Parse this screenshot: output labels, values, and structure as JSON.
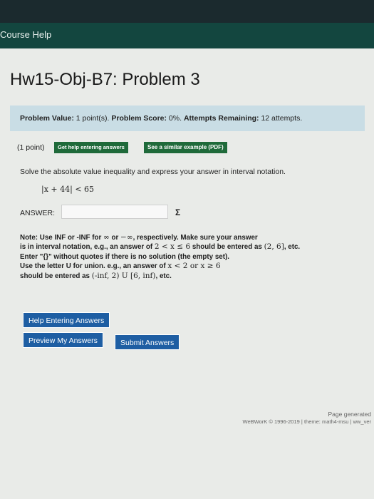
{
  "header": {
    "course_help": "Course Help"
  },
  "page": {
    "title": "Hw15-Obj-B7: Problem 3"
  },
  "info": {
    "value_label": "Problem Value:",
    "value": "1 point(s).",
    "score_label": "Problem Score:",
    "score": "0%.",
    "attempts_label": "Attempts Remaining:",
    "attempts": "12 attempts."
  },
  "problem": {
    "points": "(1 point)",
    "help_button": "Get help entering answers",
    "similar_button": "See a similar example (PDF)",
    "prompt": "Solve the absolute value inequality and express your answer in interval notation.",
    "inequality": "|x + 44| < 65",
    "answer_label": "ANSWER:",
    "answer_value": "",
    "sigma": "Σ",
    "note_line1a": "Note: Use INF or -INF for ",
    "note_line1_inf": "∞",
    "note_line1b": " or ",
    "note_line1_neginf": "−∞",
    "note_line1c": ", respectively. Make sure your answer",
    "note_line2a": "is in interval notation, e.g., an answer of ",
    "note_line2_math": "2 < x ≤ 6",
    "note_line2b": " should be entered as ",
    "note_line2_int": "(2, 6]",
    "note_line2c": ", etc.",
    "note_line3": "Enter \"{}\" without quotes if there is no solution (the empty set).",
    "note_line4a": "Use the letter U for union. e.g., an answer of ",
    "note_line4_math": "x < 2 or x ≥ 6",
    "note_line5a": "should be entered as ",
    "note_line5_math": "(-inf, 2) U [6, inf)",
    "note_line5b": ", etc."
  },
  "buttons": {
    "help_entering": "Help Entering Answers",
    "preview": "Preview My Answers",
    "submit": "Submit Answers"
  },
  "footer": {
    "generated": "Page generated",
    "copyright": "WeBWorK © 1996-2019 | theme: math4-msu | ww_ver"
  },
  "colors": {
    "nav_dark": "#1b2a2e",
    "nav_green": "#13463f",
    "info_bg": "#c9dde5",
    "green_button": "#1f6a3a",
    "blue_button": "#1e5ea3"
  }
}
